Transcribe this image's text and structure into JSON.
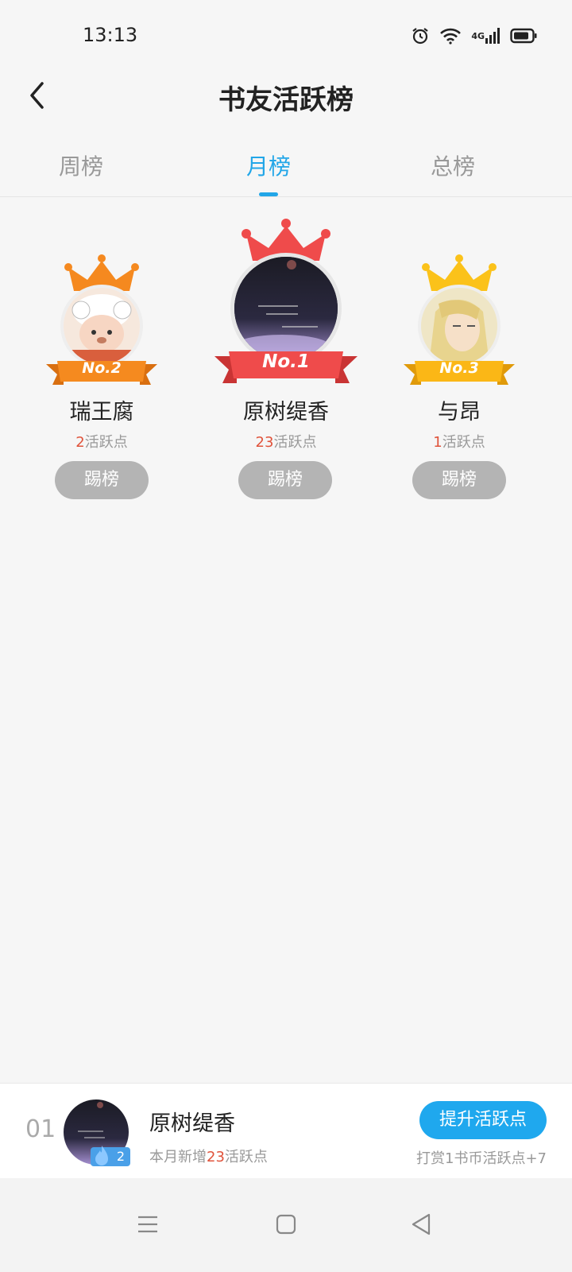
{
  "status_bar": {
    "time": "13:13",
    "network": "4G",
    "icons": [
      "alarm-icon",
      "wifi-icon",
      "cellular-signal-icon",
      "battery-icon"
    ]
  },
  "header": {
    "title": "书友活跃榜",
    "back_icon": "chevron-left-icon"
  },
  "tabs": [
    {
      "label": "周榜",
      "active": false
    },
    {
      "label": "月榜",
      "active": true
    },
    {
      "label": "总榜",
      "active": false
    }
  ],
  "podium": [
    {
      "rank_label": "No.2",
      "name": "瑞王腐",
      "points": "2",
      "points_suffix": "活跃点",
      "button": "踢榜",
      "ribbon_color": "#f58a1f",
      "crown_color": "#f5891f"
    },
    {
      "rank_label": "No.1",
      "name": "原树缇香",
      "points": "23",
      "points_suffix": "活跃点",
      "button": "踢榜",
      "ribbon_color": "#ef4b4b",
      "crown_color": "#ef4b4b"
    },
    {
      "rank_label": "No.3",
      "name": "与昂",
      "points": "1",
      "points_suffix": "活跃点",
      "button": "踢榜",
      "ribbon_color": "#fbb716",
      "crown_color": "#fbc21a"
    }
  ],
  "my_entry": {
    "rank": "01",
    "name": "原树缇香",
    "level": "2",
    "desc_prefix": "本月新增",
    "desc_points": "23",
    "desc_suffix": "活跃点",
    "boost_button": "提升活跃点",
    "reward_hint": "打赏1书币活跃点+7"
  },
  "nav_bar": {
    "icons": [
      "menu-icon",
      "home-icon",
      "back-triangle-icon"
    ]
  },
  "colors": {
    "accent": "#22a6e8",
    "points_highlight": "#e0533b",
    "kick_button": "#b4b4b4"
  }
}
